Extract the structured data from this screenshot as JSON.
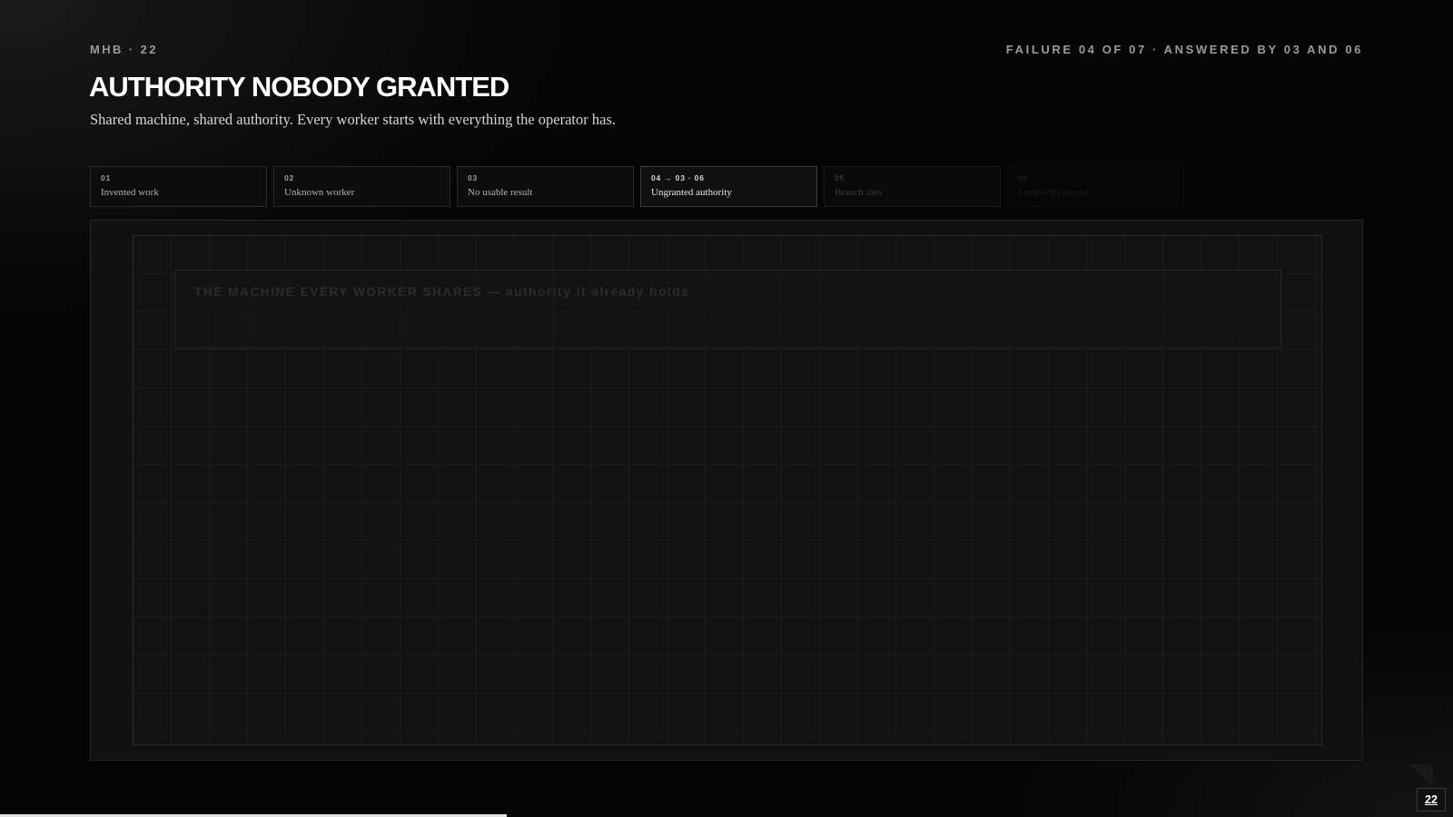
{
  "header": {
    "kicker_left": "MHB · 22",
    "kicker_right": "FAILURE 04 OF 07 · ANSWERED BY 03 AND 06",
    "title": "AUTHORITY NOBODY GRANTED",
    "subtitle": "Shared machine, shared authority. Every worker starts with everything the operator has."
  },
  "steps": [
    {
      "num": "01",
      "label": "Invented work"
    },
    {
      "num": "02",
      "label": "Unknown worker"
    },
    {
      "num": "03",
      "label": "No usable result"
    },
    {
      "num": "04 → 03 · 06",
      "label": "Ungranted authority"
    },
    {
      "num": "05",
      "label": "Branch dies"
    },
    {
      "num": "06",
      "label": "Loop with no end"
    }
  ],
  "stage": {
    "machine_label": "THE MACHINE EVERY WORKER SHARES — authority it already holds"
  },
  "footer": {
    "page_number": "22"
  },
  "colors": {
    "background": "#050505",
    "text_primary": "#ffffff",
    "text_muted": "#9a9a9a",
    "stage_bg": "#111111",
    "progress": "#e0e0e0"
  }
}
